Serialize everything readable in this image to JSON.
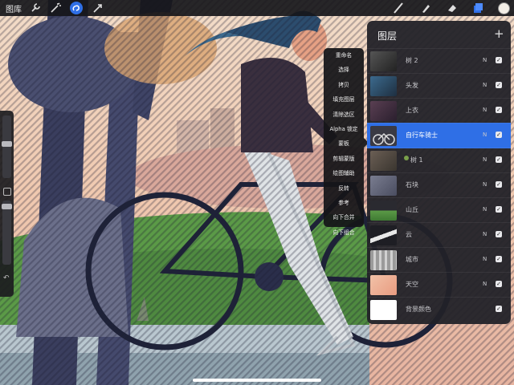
{
  "topbar": {
    "gallery_label": "图库",
    "tools_left": [
      "wrench-icon",
      "magic-wand-icon",
      "selection-icon",
      "transform-arrow-icon"
    ],
    "tools_right": [
      "brush-icon",
      "smudge-icon",
      "eraser-icon",
      "layers-icon"
    ],
    "active_tool": "selection-icon",
    "accent_color": "#2f6fe6",
    "current_color": "#f3eee6"
  },
  "context_menu": {
    "items": [
      "重命名",
      "选择",
      "拷贝",
      "填充图层",
      "清除选区",
      "Alpha 锁定",
      "蒙板",
      "剪辑蒙版",
      "绘图辅助",
      "反转",
      "参考",
      "向下合并",
      "向下组合"
    ]
  },
  "layers_panel": {
    "title": "图层",
    "add_label": "+",
    "layers": [
      {
        "name": "树 2",
        "mode": "N",
        "visible": true,
        "selected": false
      },
      {
        "name": "头发",
        "mode": "N",
        "visible": true,
        "selected": false
      },
      {
        "name": "上衣",
        "mode": "N",
        "visible": true,
        "selected": false
      },
      {
        "name": "自行车骑士",
        "mode": "N",
        "visible": true,
        "selected": true
      },
      {
        "name": "树 1",
        "mode": "N",
        "visible": true,
        "selected": false
      },
      {
        "name": "石块",
        "mode": "N",
        "visible": true,
        "selected": false
      },
      {
        "name": "山丘",
        "mode": "N",
        "visible": true,
        "selected": false
      },
      {
        "name": "云",
        "mode": "N",
        "visible": true,
        "selected": false
      },
      {
        "name": "城市",
        "mode": "N",
        "visible": true,
        "selected": false
      },
      {
        "name": "天空",
        "mode": "N",
        "visible": true,
        "selected": false
      },
      {
        "name": "背景颜色",
        "mode": "",
        "visible": true,
        "selected": false
      }
    ]
  }
}
